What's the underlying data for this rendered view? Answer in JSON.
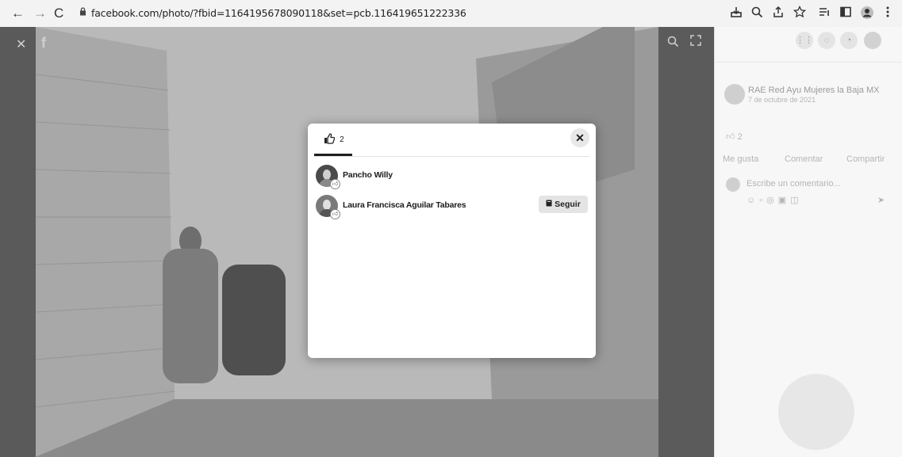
{
  "browser": {
    "back": "←",
    "forward": "→",
    "reload": "C",
    "url": "facebook.com/photo/?fbid=1164195678090118&set=pcb.116419651222336",
    "toolbar_icons": [
      "download-icon",
      "zoom-icon",
      "share-icon",
      "star-icon",
      "reading-list-icon",
      "window-icon",
      "profile-icon",
      "menu-icon"
    ]
  },
  "photo_viewer": {
    "close_glyph": "✕",
    "logo_glyph": "f"
  },
  "side_panel": {
    "post_author": "RAE Red Ayu Mujeres la Baja MX",
    "post_time": "7 de octubre de 2021",
    "reaction_count": "2",
    "actions": [
      "Me gusta",
      "Comentar",
      "Compartir"
    ],
    "comment_placeholder": "Escribe un comentario..."
  },
  "reactions_dialog": {
    "tab_all_count": "2",
    "close_glyph": "✕",
    "people": [
      {
        "name": "Pancho Willy",
        "button": null
      },
      {
        "name": "Laura Francisca Aguilar Tabares",
        "button": "Seguir"
      }
    ],
    "colors": {
      "underline": "#1f1f1f",
      "button_bg": "#e4e4e4"
    }
  }
}
